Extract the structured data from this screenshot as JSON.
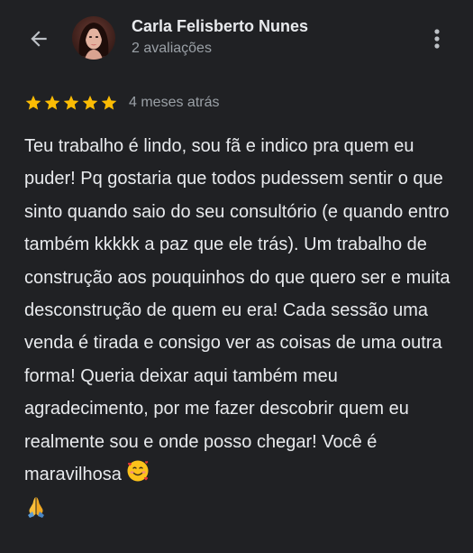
{
  "header": {
    "back_icon": "arrow-back-icon",
    "reviewer_name": "Carla Felisberto Nunes",
    "review_count": "2 avaliações",
    "more_icon": "more-vert-icon"
  },
  "review": {
    "rating": 5,
    "rating_max": 5,
    "star_color": "#fbbc04",
    "date": "4 meses atrás",
    "text": "Teu trabalho é lindo, sou fã e indico pra quem eu puder! Pq gostaria que todos pudessem sentir o que sinto quando saio do seu consultório (e quando entro também kkkkk a paz que ele trás). Um trabalho de construção aos pouquinhos do que quero ser e muita desconstrução de quem eu era! Cada sessão uma venda é tirada e consigo ver as coisas de uma outra forma! Queria deixar aqui também meu agradecimento, por me fazer descobrir quem eu realmente sou e onde posso chegar! Você é maravilhosa",
    "emojis": [
      "smiling-face-with-hearts-emoji",
      "folded-hands-emoji"
    ]
  },
  "colors": {
    "background": "#202124",
    "primary_text": "#e8eaed",
    "secondary_text": "#9aa0a6"
  }
}
